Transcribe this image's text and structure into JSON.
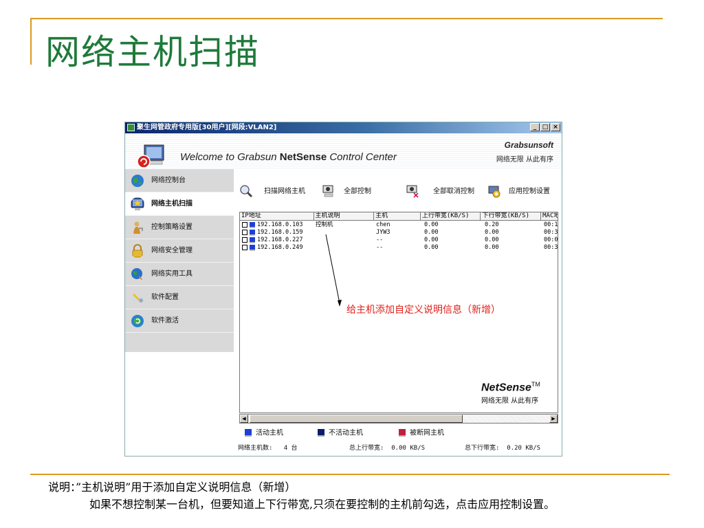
{
  "slide": {
    "title": "网络主机扫描",
    "note_line1": "说明：”主机说明”用于添加自定义说明信息（新增）",
    "note_line2": "如果不想控制某一台机，但要知道上下行带宽,只须在要控制的主机前勾选，点击应用控制设置。"
  },
  "window": {
    "title": "聚生网管政府专用版[30用户][网段:VLAN2]",
    "buttons": {
      "minimize": "_",
      "maximize": "□",
      "close": "×"
    }
  },
  "banner": {
    "welcome_prefix": "Welcome to Grabsun ",
    "welcome_bold": "NetSense",
    "welcome_suffix": " Control  Center",
    "brand": "Grabsunsoft",
    "brand_sub": "网络无限 从此有序"
  },
  "sidebar": {
    "items": [
      {
        "label": "网络控制台",
        "icon": "globe-icon"
      },
      {
        "label": "网络主机扫描",
        "icon": "monitor-star-icon",
        "active": true
      },
      {
        "label": "控制策略设置",
        "icon": "person-key-icon"
      },
      {
        "label": "网络安全管理",
        "icon": "padlock-icon"
      },
      {
        "label": "网络实用工具",
        "icon": "globe-arrow-icon"
      },
      {
        "label": "软件配置",
        "icon": "wrench-icon"
      },
      {
        "label": "软件激活",
        "icon": "activate-icon"
      }
    ]
  },
  "toolbar": {
    "scan": "扫描网络主机",
    "control_all": "全部控制",
    "uncontrol_all": "全部取消控制",
    "apply": "应用控制设置"
  },
  "grid": {
    "columns": [
      "IP地址",
      "主机说明",
      "主机",
      "上行带宽(KB/S)",
      "下行带宽(KB/S)",
      "MAC地"
    ],
    "rows": [
      {
        "ip": "192.168.0.103",
        "desc": "控制机",
        "host": "chen",
        "up": "0.00",
        "down": "0.20",
        "mac": "00:1"
      },
      {
        "ip": "192.168.0.159",
        "desc": "",
        "host": "JYW3",
        "up": "0.00",
        "down": "0.00",
        "mac": "00:3"
      },
      {
        "ip": "192.168.0.227",
        "desc": "",
        "host": "--",
        "up": "0.00",
        "down": "0.00",
        "mac": "00:0"
      },
      {
        "ip": "192.168.0.249",
        "desc": "",
        "host": "--",
        "up": "0.00",
        "down": "0.00",
        "mac": "00:3"
      }
    ]
  },
  "annotation": "给主机添加自定义说明信息（新增）",
  "watermark": {
    "brand": "NetSense",
    "tm": "TM",
    "sub": "网络无限 从此有序"
  },
  "legend": {
    "active": {
      "label": "活动主机",
      "color": "#1e3fd6"
    },
    "inactive": {
      "label": "不活动主机",
      "color": "#0a1f6a"
    },
    "cut": {
      "label": "被断网主机",
      "color": "#c0203a"
    }
  },
  "status": {
    "host_count_label": "网络主机数:",
    "host_count": "4 台",
    "up_total_label": "总上行带宽:",
    "up_total": "0.00 KB/S",
    "down_total_label": "总下行带宽:",
    "down_total": "0.20 KB/S"
  }
}
